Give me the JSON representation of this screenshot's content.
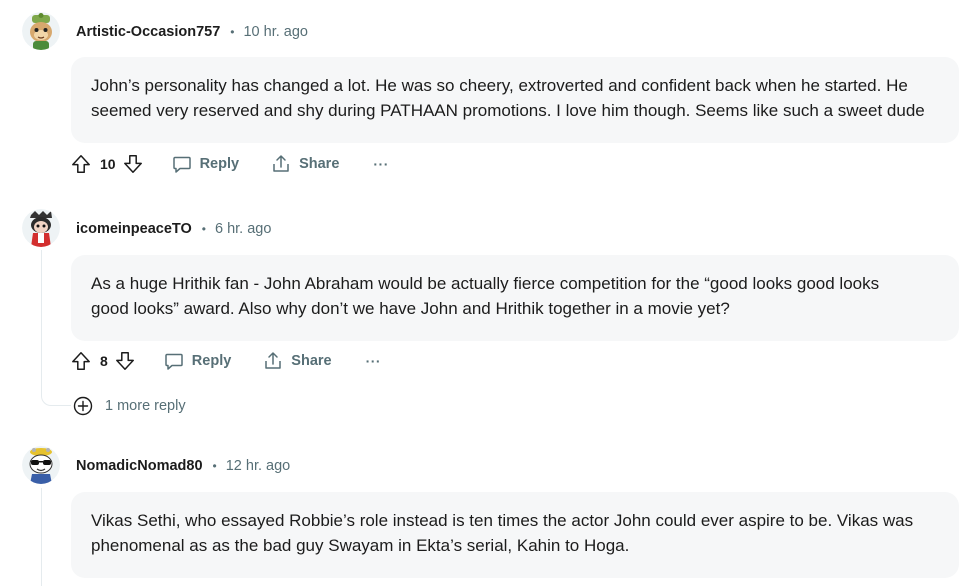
{
  "comments": [
    {
      "username": "Artistic-Occasion757",
      "time": "10 hr. ago",
      "avatar_icon": "snoo-avatar-green-hat-icon",
      "body": "John’s personality has changed a lot. He was so cheery, extroverted and confident back when he started. He\nseemed very reserved and shy during PATHAAN promotions. I love him though. Seems like such a sweet dude",
      "score": "10",
      "reply_label": "Reply",
      "share_label": "Share",
      "more_label": "···"
    },
    {
      "username": "icomeinpeaceTO",
      "time": "6 hr. ago",
      "avatar_icon": "snoo-avatar-red-icon",
      "body": "As a huge Hrithik fan - John Abraham would be actually fierce competition for the “good looks good looks\ngood looks” award. Also why don’t we have John and Hrithik together in a movie yet?",
      "score": "8",
      "reply_label": "Reply",
      "share_label": "Share",
      "more_label": "···",
      "more_replies_label": "1 more reply"
    },
    {
      "username": "NomadicNomad80",
      "time": "12 hr. ago",
      "avatar_icon": "snoo-avatar-sunglasses-icon",
      "body": "Vikas Sethi, who essayed Robbie’s role instead is ten times the actor John could ever aspire to be. Vikas was\nphenomenal as as the bad guy Swayam in Ekta’s serial, Kahin to Hoga."
    }
  ],
  "separator": "•",
  "colors": {
    "text": "#1c1c1c",
    "meta": "#576f76",
    "bubble": "#f6f7f8",
    "thread_line": "#e5ebee"
  }
}
